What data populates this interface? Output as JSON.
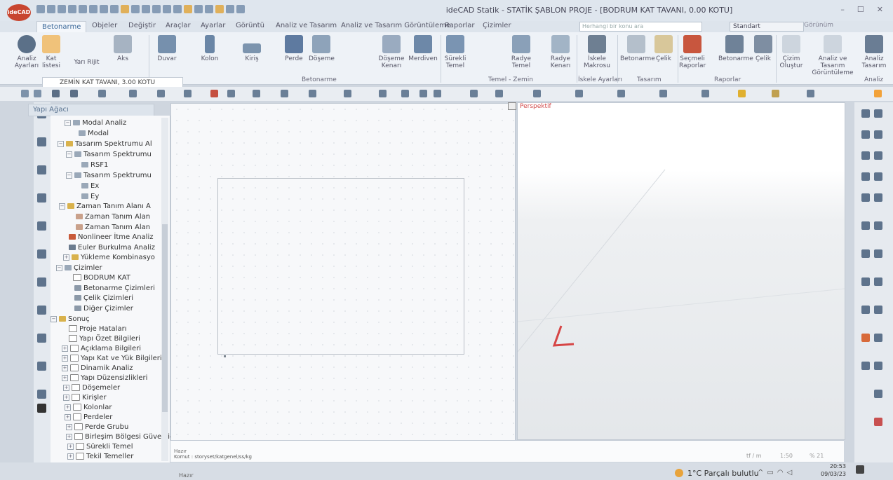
{
  "app": {
    "logo_text": "ideCAD",
    "title": "ideCAD Statik - STATİK ŞABLON PROJE - [BODRUM KAT TAVANI, 0.00 KOTU]"
  },
  "menu_tabs": [
    {
      "label": "Betonarme",
      "active": true
    },
    {
      "label": "Objeler"
    },
    {
      "label": "Değiştir"
    },
    {
      "label": "Araçlar"
    },
    {
      "label": "Ayarlar"
    },
    {
      "label": "Görüntü"
    },
    {
      "label": "Analiz ve Tasarım"
    },
    {
      "label": "Analiz ve Tasarım Görüntüleme"
    },
    {
      "label": "Raporlar"
    },
    {
      "label": "Çizimler"
    }
  ],
  "search_placeholder": "Herhangi bir konu ara",
  "style_select": "Standart",
  "view_label": "Görünüm",
  "ribbon": {
    "buttons": {
      "analiz_ayarlari": "Analiz Ayarları",
      "kat_listesi": "Kat listesi",
      "yari_rijit": "Yarı Rijit",
      "aks": "Aks",
      "duvar": "Duvar",
      "kolon": "Kolon",
      "kiris": "Kiriş",
      "perde": "Perde",
      "doseme": "Döşeme",
      "doseme_kenari": "Döşeme Kenarı",
      "merdiven": "Merdiven",
      "surekli_temel": "Sürekli Temel",
      "radye_temel": "Radye Temel",
      "radye_kenari": "Radye Kenarı",
      "iskele_makrosu": "İskele Makrosu",
      "betonarme": "Betonarme",
      "celik": "Çelik",
      "secmeli_raporlar": "Seçmeli Raporlar",
      "betonarme2": "Betonarme",
      "celik2": "Çelik",
      "cizim_olustur": "Çizim Oluştur",
      "analiz_goruntuleme": "Analiz ve Tasarım Görüntüleme",
      "analiz_tasarim": "Analiz Tasarım"
    },
    "groups": {
      "duvar": "uvar",
      "betonarme": "Betonarme",
      "temel_zemin": "Temel - Zemin",
      "iskele_ayarlari": "İskele Ayarları",
      "tasarim": "Tasarım",
      "raporlar": "Raporlar",
      "analiz": "Analiz"
    }
  },
  "floor_selector": "ZEMİN KAT TAVANI, 3.00 KOTU",
  "tree": {
    "title": "Yapı Ağacı",
    "items": [
      "Modal Analiz",
      "Modal",
      "Tasarım Spektrumu Al",
      "Tasarım Spektrumu",
      "RSF1",
      "Tasarım Spektrumu",
      "Ex",
      "Ey",
      "Zaman Tanım Alanı A",
      "Zaman Tanım Alan",
      "Zaman Tanım Alan",
      "Nonlineer İtme Analiz",
      "Euler Burkulma Analiz",
      "Yükleme Kombinasyo",
      "Çizimler",
      "BODRUM KAT",
      "Betonarme Çizimleri",
      "Çelik Çizimleri",
      "Diğer Çizimler",
      "Sonuç",
      "Proje Hataları",
      "Yapı Özet Bilgileri",
      "Açıklama Bilgileri",
      "Yapı Kat ve Yük Bilgileri",
      "Dinamik Analiz",
      "Yapı Düzensizlikleri",
      "Döşemeler",
      "Kirişler",
      "Kolonlar",
      "Perdeler",
      "Perde Grubu",
      "Birleşim Bölgesi Güvenliğ",
      "Sürekli Temel",
      "Tekil Temeller"
    ]
  },
  "perspective_label": "Perspektif",
  "command": {
    "status": "Hazır",
    "text": "Komut : storyset/katgenel/ss/kg",
    "unit": "tf / m",
    "scale": "1:50",
    "zoom": "% 21"
  },
  "bottom_status": "Hazır",
  "taskbar": {
    "weather": "1°C  Parçalı bulutlu",
    "time": "20:53",
    "date": "09/03/23"
  }
}
